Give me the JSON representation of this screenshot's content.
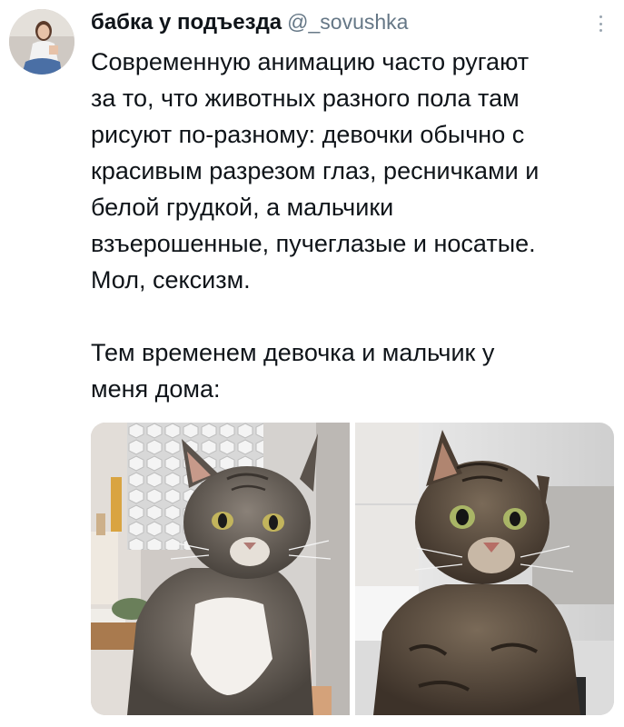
{
  "tweet": {
    "author": {
      "name": "бабка у подъезда",
      "handle": "@_sovushka"
    },
    "text_lines": [
      "Современную анимацию часто ругают",
      "за то, что животных разного пола там",
      "рисуют по-разному: девочки обычно с",
      "красивым разрезом глаз, ресничками и",
      "белой грудкой, а мальчики",
      "взъерошенные, пучеглазые и носатые.",
      "Мол, сексизм."
    ],
    "text_lines_2": [
      "Тем временем девочка и мальчик у",
      "меня дома:"
    ],
    "more_icon": "more-vertical-icon"
  },
  "colors": {
    "text": "#0f1419",
    "handle": "#657786"
  }
}
